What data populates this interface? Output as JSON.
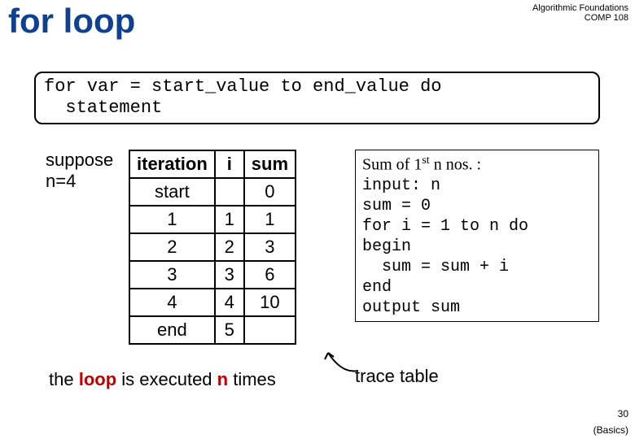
{
  "course": {
    "line1": "Algorithmic Foundations",
    "line2": "COMP 108"
  },
  "title": "for loop",
  "syntax": {
    "line1": "for var = start_value to end_value do",
    "line2": "  statement"
  },
  "suppose": {
    "line1": "suppose",
    "line2": "n=4"
  },
  "table": {
    "headers": [
      "iteration",
      "i",
      "sum"
    ],
    "rows": [
      [
        "start",
        "",
        "0"
      ],
      [
        "1",
        "1",
        "1"
      ],
      [
        "2",
        "2",
        "3"
      ],
      [
        "3",
        "3",
        "6"
      ],
      [
        "4",
        "4",
        "10"
      ],
      [
        "end",
        "5",
        ""
      ]
    ]
  },
  "algo": {
    "heading_prefix": "Sum of 1",
    "heading_sup": "st",
    "heading_suffix": " n nos. :",
    "lines": [
      "input: n",
      "sum = 0",
      "for i = 1 to n do",
      "begin",
      "  sum = sum + i",
      "end",
      "output sum"
    ]
  },
  "note": {
    "t1": "the ",
    "loop": "loop",
    "t2": " is executed ",
    "n": "n",
    "t3": " times"
  },
  "trace_label": "trace table",
  "page": "30",
  "footer": "(Basics)"
}
